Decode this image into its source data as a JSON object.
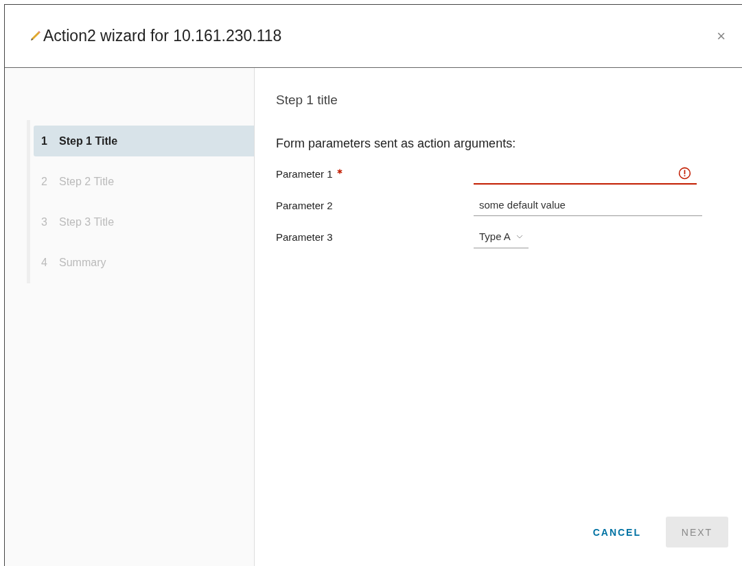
{
  "window": {
    "title": "Action2 wizard for 10.161.230.118",
    "close": "×"
  },
  "steps": [
    {
      "number": "1",
      "label": "Step 1 Title",
      "selected": true,
      "disabled": false
    },
    {
      "number": "2",
      "label": "Step 2 Title",
      "selected": false,
      "disabled": true
    },
    {
      "number": "3",
      "label": "Step 3 Title",
      "selected": false,
      "disabled": true
    },
    {
      "number": "4",
      "label": "Summary",
      "selected": false,
      "disabled": true
    }
  ],
  "content": {
    "heading": "Step 1 title",
    "intro": "Form parameters sent as action arguments:",
    "fields": [
      {
        "kind": "text",
        "label": "Parameter 1",
        "required": true,
        "error": true
      },
      {
        "kind": "text",
        "label": "Parameter 2",
        "required": false,
        "error": false,
        "value": "some default value"
      },
      {
        "kind": "select",
        "label": "Parameter 3",
        "required": false,
        "error": false,
        "value": "Type A"
      }
    ]
  },
  "buttons": [
    {
      "kind": "link",
      "label": "CANCEL",
      "disabled": false
    },
    {
      "kind": "primary",
      "label": "NEXT",
      "disabled": true
    }
  ]
}
